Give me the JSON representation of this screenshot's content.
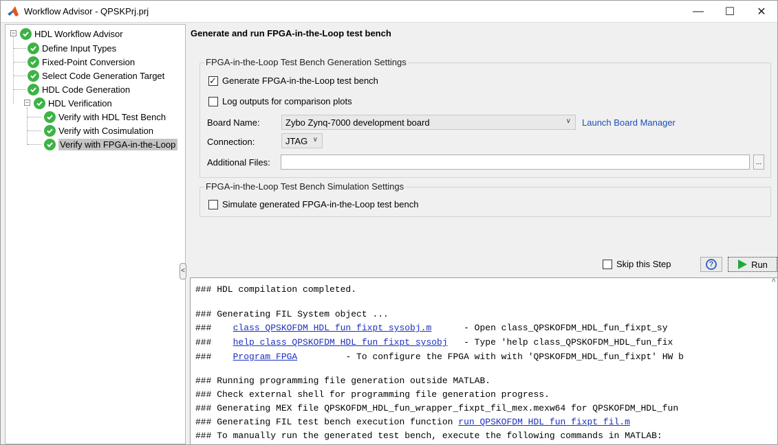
{
  "window": {
    "title": "Workflow Advisor - QPSKPrj.prj",
    "minimize": "—",
    "maximize": "☐",
    "close": "✕"
  },
  "tree": {
    "items": [
      {
        "label": "HDL Workflow Advisor",
        "expander": "−"
      },
      {
        "label": "Define Input Types"
      },
      {
        "label": "Fixed-Point Conversion"
      },
      {
        "label": "Select Code Generation Target"
      },
      {
        "label": "HDL Code Generation"
      },
      {
        "label": "HDL Verification",
        "expander": "−"
      },
      {
        "label": "Verify with HDL Test Bench"
      },
      {
        "label": "Verify with Cosimulation"
      },
      {
        "label": "Verify with FPGA-in-the-Loop",
        "selected": true
      }
    ],
    "collapse_glyph": "<"
  },
  "panel": {
    "title": "Generate and run FPGA-in-the-Loop test bench",
    "gen_group": {
      "title": "FPGA-in-the-Loop Test Bench Generation Settings",
      "generate_cb": {
        "label": "Generate FPGA-in-the-Loop test bench",
        "checked": "✓"
      },
      "log_cb": {
        "label": "Log outputs for comparison plots"
      },
      "board_label": "Board Name:",
      "board_value": "Zybo Zynq-7000 development board",
      "launch_link": "Launch Board Manager",
      "connection_label": "Connection:",
      "connection_value": "JTAG",
      "files_label": "Additional Files:",
      "files_value": "",
      "browse": "..."
    },
    "sim_group": {
      "title": "FPGA-in-the-Loop Test Bench Simulation Settings",
      "simulate_cb": {
        "label": "Simulate generated FPGA-in-the-Loop test bench"
      }
    },
    "skip_label": "Skip this Step",
    "help": "?",
    "run": "Run"
  },
  "console": {
    "lines": {
      "l1": "### HDL compilation completed.",
      "l2": "### Generating FIL System object ...",
      "l3_prefix": "###    ",
      "l3_link": "class_QPSKOFDM_HDL_fun_fixpt_sysobj.m",
      "l3_text": "      - Open class_QPSKOFDM_HDL_fun_fixpt_sy",
      "l4_prefix": "###    ",
      "l4_link": "help class_QPSKOFDM_HDL_fun_fixpt_sysobj",
      "l4_text": "   - Type 'help class_QPSKOFDM_HDL_fun_fix",
      "l5_prefix": "###    ",
      "l5_link": "Program FPGA",
      "l5_text": "         - To configure the FPGA with with 'QPSKOFDM_HDL_fun_fixpt' HW b",
      "l6": "### Running programming file generation outside MATLAB.",
      "l7": "### Check external shell for programming file generation progress.",
      "l8": "### Generating MEX file QPSKOFDM_HDL_fun_wrapper_fixpt_fil_mex.mexw64 for QPSKOFDM_HDL_fun",
      "l9_prefix": "### Generating FIL test bench execution function ",
      "l9_link": "run_QPSKOFDM_HDL_fun_fixpt_fil.m",
      "l10": "### To manually run the generated test bench, execute the following commands in MATLAB:"
    },
    "scroll_glyph": "^"
  }
}
